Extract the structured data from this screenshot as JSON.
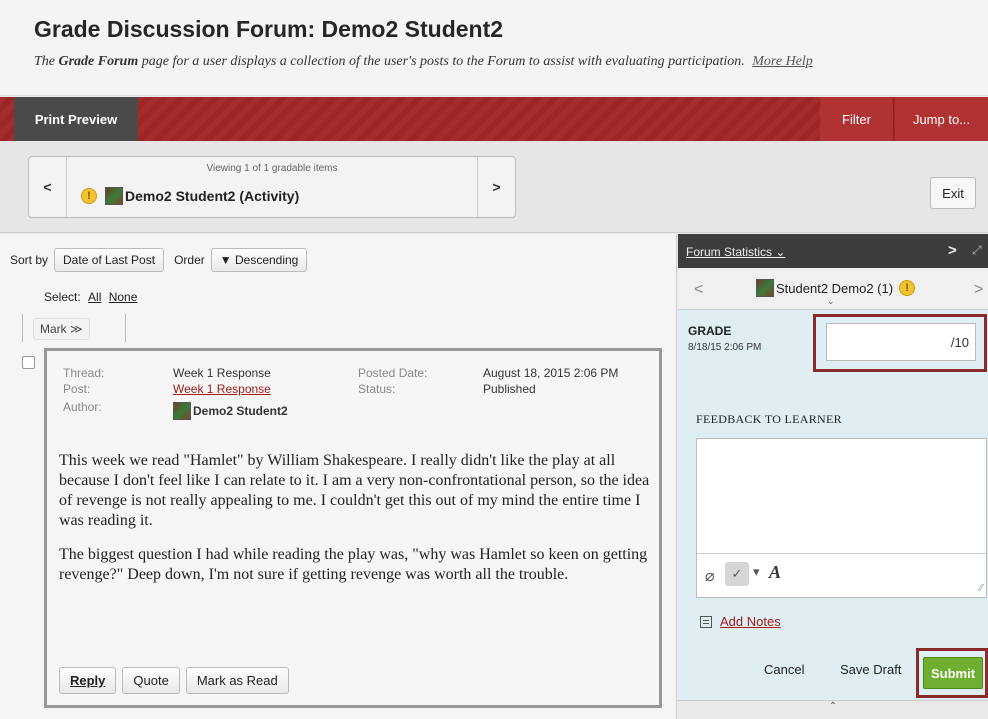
{
  "header": {
    "title": "Grade Discussion Forum: Demo2 Student2",
    "subtitle_pre": "The ",
    "subtitle_bold": "Grade Forum",
    "subtitle_post": " page for a user displays a collection of the user's posts to the Forum to assist with evaluating participation.",
    "more_help": "More Help"
  },
  "actionbar": {
    "print_preview": "Print Preview",
    "filter": "Filter",
    "jump_to": "Jump to..."
  },
  "viewer": {
    "viewing": "Viewing 1 of 1 gradable items",
    "user": "Demo2 Student2 (Activity)",
    "prev": "<",
    "next": ">",
    "exit": "Exit"
  },
  "sortbar": {
    "sort_by": "Sort by",
    "sort_value": "Date of Last Post",
    "order": "Order",
    "order_value": "▼ Descending"
  },
  "select": {
    "label": "Select:",
    "all": "All",
    "none": "None"
  },
  "mark": {
    "label": "Mark ≫"
  },
  "post": {
    "thread_label": "Thread:",
    "thread": "Week 1 Response",
    "post_label": "Post:",
    "post": "Week 1 Response",
    "author_label": "Author:",
    "author": "Demo2 Student2",
    "posted_label": "Posted Date:",
    "posted": "August 18, 2015 2:06 PM",
    "status_label": "Status:",
    "status": "Published",
    "body_p1": "This week we read \"Hamlet\" by William Shakespeare. I really didn't like the play at all because I don't feel like I can relate to it. I am a very non-confrontational person, so the idea of revenge is not really appealing to me. I couldn't get this out of my mind the entire time I was reading it.",
    "body_p2": "The biggest question I had while reading the play was, \"why was Hamlet so keen on getting revenge?\" Deep down, I'm not sure if getting revenge was worth all the trouble.",
    "reply": "Reply",
    "quote": "Quote",
    "mark_read": "Mark as Read"
  },
  "rightpanel": {
    "forum_stats": "Forum Statistics ⌄",
    "next": ">",
    "user": "Student2 Demo2 (1)",
    "grade_label": "GRADE",
    "grade_date": "8/18/15 2:06 PM",
    "grade_max": "/10",
    "feedback_label": "FEEDBACK TO LEARNER",
    "add_notes": "Add Notes",
    "cancel": "Cancel",
    "save_draft": "Save Draft",
    "submit": "Submit"
  },
  "icons": {
    "alert": "alert-icon",
    "avatar": "avatar-icon",
    "attach": "paperclip-icon",
    "spell": "spellcheck-icon",
    "font": "font-icon",
    "notes": "notes-icon"
  },
  "colors": {
    "accent_red": "#a52c2c",
    "submit_green": "#6fae2f",
    "highlight_border": "#8b2a2a",
    "link_red": "#a31c1c"
  }
}
